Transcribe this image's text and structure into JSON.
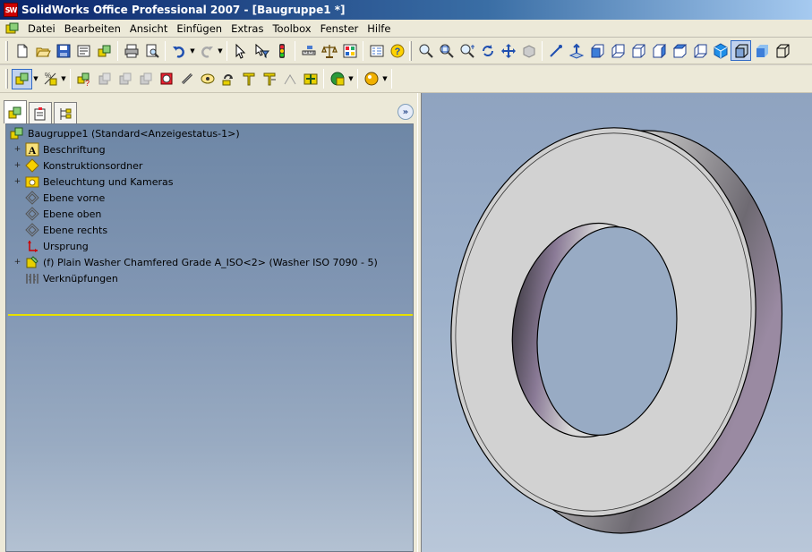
{
  "window": {
    "title": "SolidWorks Office Professional 2007 - [Baugruppe1 *]",
    "app_icon_text": "SW"
  },
  "menubar": {
    "items": [
      "Datei",
      "Bearbeiten",
      "Ansicht",
      "Einfügen",
      "Extras",
      "Toolbox",
      "Fenster",
      "Hilfe"
    ]
  },
  "toolbars": {
    "standard": [
      "new-icon",
      "open-icon",
      "save-icon",
      "properties-icon",
      "make-assembly-icon",
      "print-icon",
      "print-preview-icon",
      "undo-icon",
      "redo-icon",
      "select-icon",
      "select-filter-icon",
      "rebuild-icon",
      "options-icon",
      "measure-icon",
      "layout-icon",
      "help-icon"
    ],
    "view": [
      "zoom-fit-icon",
      "zoom-area-icon",
      "zoom-inout-icon",
      "rotate-icon",
      "pan-icon",
      "previous-view-icon",
      "section-view-icon",
      "normal-to-icon",
      "view-1-icon",
      "view-2-icon",
      "view-3-icon",
      "view-4-icon",
      "view-5-icon",
      "view-6-icon",
      "shaded-icon",
      "shaded-edges-icon",
      "wireframe-icon"
    ],
    "assembly": [
      "edit-component-icon",
      "insert-component-icon",
      "hide-show-icon",
      "change-suppression-icon",
      "smart-fasteners-icon",
      "mate-icon",
      "move-component-icon",
      "rotate-component-icon",
      "explode-icon",
      "exploded-sketch-icon",
      "interference-icon",
      "feature-icon",
      "toolbox-icon"
    ]
  },
  "feature_manager": {
    "tabs": [
      "featuremanager-tab",
      "propertymanager-tab",
      "configurationmanager-tab"
    ],
    "expand_glyph": "»",
    "tree": [
      {
        "label": "Baugruppe1  (Standard<Anzeigestatus-1>)",
        "icon": "assembly-icon",
        "expandable": false,
        "indent": 0
      },
      {
        "label": "Beschriftung",
        "icon": "annotation-icon",
        "expandable": true,
        "indent": 1
      },
      {
        "label": "Konstruktionsordner",
        "icon": "design-folder-icon",
        "expandable": true,
        "indent": 1
      },
      {
        "label": "Beleuchtung und Kameras",
        "icon": "lights-cameras-icon",
        "expandable": true,
        "indent": 1
      },
      {
        "label": "Ebene vorne",
        "icon": "plane-icon",
        "expandable": false,
        "indent": 1
      },
      {
        "label": "Ebene oben",
        "icon": "plane-icon",
        "expandable": false,
        "indent": 1
      },
      {
        "label": "Ebene rechts",
        "icon": "plane-icon",
        "expandable": false,
        "indent": 1
      },
      {
        "label": "Ursprung",
        "icon": "origin-icon",
        "expandable": false,
        "indent": 1
      },
      {
        "label": "(f) Plain Washer Chamfered Grade A_ISO<2> (Washer ISO 7090 - 5)",
        "icon": "part-icon",
        "expandable": true,
        "indent": 1
      },
      {
        "label": "Verknüpfungen",
        "icon": "mates-icon",
        "expandable": false,
        "indent": 1
      }
    ]
  },
  "colors": {
    "title_bar_start": "#0a246a",
    "title_bar_end": "#a6caf0",
    "viewport_top": "#8fa3c0",
    "viewport_bottom": "#b9c7d9",
    "rollback_bar": "#e8e000"
  },
  "model": {
    "name": "washer-3d-model"
  }
}
